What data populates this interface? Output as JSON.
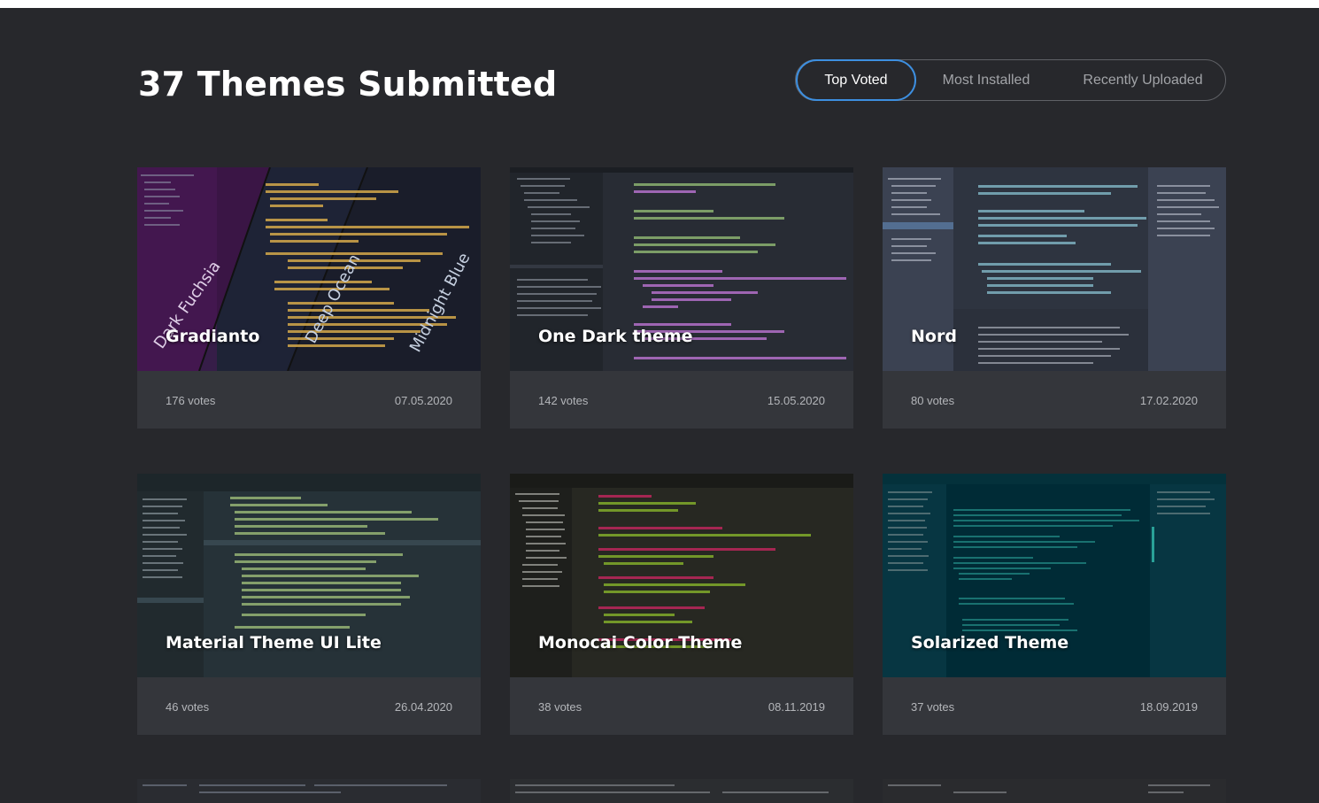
{
  "page": {
    "title": "37 Themes Submitted"
  },
  "sort_tabs": [
    {
      "label": "Top Voted",
      "active": true
    },
    {
      "label": "Most Installed",
      "active": false
    },
    {
      "label": "Recently Uploaded",
      "active": false
    }
  ],
  "themes": [
    {
      "name": "Gradianto",
      "votes": "176 votes",
      "date": "07.05.2020",
      "variants": [
        "Dark Fuchsia",
        "Deep Ocean",
        "Midnight Blue"
      ],
      "colors": [
        "#3a1a45",
        "#1d2235",
        "#1b1e2c"
      ]
    },
    {
      "name": "One Dark theme",
      "votes": "142 votes",
      "date": "15.05.2020",
      "colors": [
        "#21252b",
        "#282c34"
      ]
    },
    {
      "name": "Nord",
      "votes": "80 votes",
      "date": "17.02.2020",
      "colors": [
        "#2e3440",
        "#3b4252"
      ]
    },
    {
      "name": "Material Theme UI Lite",
      "votes": "46 votes",
      "date": "26.04.2020",
      "colors": [
        "#263238",
        "#2b3a42"
      ]
    },
    {
      "name": "Monocai Color Theme",
      "votes": "38 votes",
      "date": "08.11.2019",
      "colors": [
        "#1e1f1c",
        "#272822"
      ]
    },
    {
      "name": "Solarized Theme",
      "votes": "37 votes",
      "date": "18.09.2019",
      "colors": [
        "#002b36",
        "#073642"
      ]
    }
  ],
  "accent_color": "#3d8fe0"
}
